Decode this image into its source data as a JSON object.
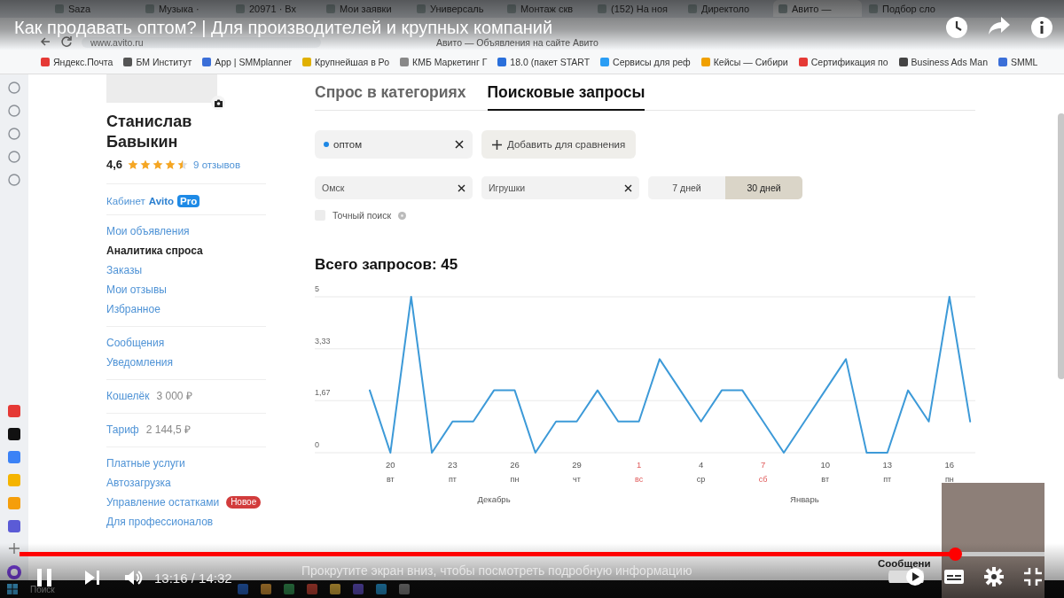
{
  "video": {
    "title": "Как продавать оптом? | Для производителей и крупных компаний",
    "progress": {
      "level": 0.913
    },
    "time": "13:16 / 14:32",
    "hint": "Прокрутите экран вниз, чтобы посмотреть подробную информацию",
    "autoplay": {
      "on": true
    }
  },
  "browser": {
    "tabs": [
      {
        "label": "Saza",
        "selected": false
      },
      {
        "label": "Музыка ·",
        "selected": false
      },
      {
        "label": "20971 · Вх",
        "selected": false
      },
      {
        "label": "Мои заявки",
        "selected": false
      },
      {
        "label": "Универсаль",
        "selected": false
      },
      {
        "label": "Монтаж скв",
        "selected": false
      },
      {
        "label": "(152) На ноя",
        "selected": false
      },
      {
        "label": "Директоло",
        "selected": false
      },
      {
        "label": "Авито —",
        "selected": true
      },
      {
        "label": "Подбор сло",
        "selected": false
      }
    ],
    "address": "www.avito.ru",
    "page_title": "Авито — Объявления на сайте Авито",
    "bookmarks": [
      {
        "label": "Яндекс.Почта",
        "color": "#e53935"
      },
      {
        "label": "БМ Институт",
        "color": "#555555"
      },
      {
        "label": "App | SMMplanner",
        "color": "#3b6fd8"
      },
      {
        "label": "Крупнейшая в Ро",
        "color": "#e0b000"
      },
      {
        "label": "КМБ Маркетинг Г",
        "color": "#888888"
      },
      {
        "label": "18.0 (пакет START",
        "color": "#2a6fdb"
      },
      {
        "label": "Сервисы для реф",
        "color": "#2a9df4"
      },
      {
        "label": "Кейсы — Сибири",
        "color": "#f0a000"
      },
      {
        "label": "Сертификация по",
        "color": "#e53935"
      },
      {
        "label": "Business Ads Man",
        "color": "#444444"
      },
      {
        "label": "SMML",
        "color": "#3b6fd8"
      }
    ]
  },
  "profile": {
    "name": "Станислав Бавыкин",
    "rating": "4,6",
    "stars": 4.5,
    "reviews": "9 отзывов",
    "cabinet": {
      "label": "Кабинет",
      "brand": "Avito",
      "badge": "Pro"
    },
    "menu_groups": [
      {
        "items": [
          {
            "label": "Мои объявления",
            "selected": false
          },
          {
            "label": "Аналитика спроса",
            "selected": true
          },
          {
            "label": "Заказы",
            "selected": false
          },
          {
            "label": "Мои отзывы",
            "selected": false
          },
          {
            "label": "Избранное",
            "selected": false
          }
        ]
      },
      {
        "items": [
          {
            "label": "Сообщения",
            "selected": false
          },
          {
            "label": "Уведомления",
            "selected": false
          }
        ]
      },
      {
        "items": [
          {
            "label": "Кошелёк",
            "value": "3 000 ₽",
            "selected": false
          }
        ]
      },
      {
        "items": [
          {
            "label": "Тариф",
            "value": "2 144,5 ₽",
            "selected": false
          }
        ]
      },
      {
        "items": [
          {
            "label": "Платные услуги",
            "selected": false
          },
          {
            "label": "Автозагрузка",
            "selected": false
          },
          {
            "label": "Управление остатками",
            "badge": "Новое",
            "selected": false
          },
          {
            "label": "Для профессионалов",
            "selected": false
          }
        ]
      }
    ]
  },
  "analytics": {
    "tabs": [
      {
        "label": "Спрос в категориях",
        "selected": false
      },
      {
        "label": "Поисковые запросы",
        "selected": true
      }
    ],
    "queries": [
      {
        "text": "оптом",
        "color": "#1e88e5"
      }
    ],
    "add_button": "Добавить для сравнения",
    "filters": [
      {
        "value": "Омск"
      },
      {
        "value": "Игрушки"
      }
    ],
    "periods": [
      {
        "label": "7 дней",
        "selected": false
      },
      {
        "label": "30 дней",
        "selected": true
      }
    ],
    "exact_search": {
      "label": "Точный поиск",
      "checked": false
    },
    "total": "Всего запросов: 45",
    "chart_data": {
      "type": "line",
      "categories": [
        null,
        "20",
        null,
        null,
        "23",
        null,
        null,
        "26",
        null,
        null,
        "29",
        null,
        null,
        "1",
        null,
        null,
        "4",
        null,
        null,
        "7",
        null,
        null,
        "10",
        null,
        null,
        "13",
        null,
        null,
        "16",
        null
      ],
      "series": [
        {
          "color": "#3d9ad8",
          "values": [
            2,
            0,
            5,
            0,
            1,
            1,
            2,
            2,
            0,
            1,
            1,
            2,
            1,
            1,
            3,
            2,
            1,
            2,
            2,
            1,
            0,
            1,
            2,
            3,
            0,
            0,
            2,
            1,
            5,
            1
          ]
        }
      ],
      "ylim": [
        0,
        5
      ],
      "yticks": [
        0,
        {
          "value": 1.67,
          "label": "1,67"
        },
        {
          "value": 3.33,
          "label": "3,33"
        },
        5
      ]
    },
    "axis_labels": {
      "weekdays": [
        {
          "label": "вт",
          "holiday": false
        },
        {
          "label": "пт",
          "holiday": false
        },
        {
          "label": "пн",
          "holiday": false
        },
        {
          "label": "чт",
          "holiday": false
        },
        {
          "label": "вс",
          "holiday": true
        },
        {
          "label": "ср",
          "holiday": false
        },
        {
          "label": "сб",
          "holiday": true
        },
        {
          "label": "вт",
          "holiday": false
        },
        {
          "label": "пт",
          "holiday": false
        },
        {
          "label": "пн",
          "holiday": false
        }
      ],
      "months": [
        {
          "label": "Декабрь"
        },
        {
          "label": "Январь"
        }
      ]
    }
  },
  "messenger": "Сообщени",
  "taskbar": {
    "search": "Поиск"
  }
}
